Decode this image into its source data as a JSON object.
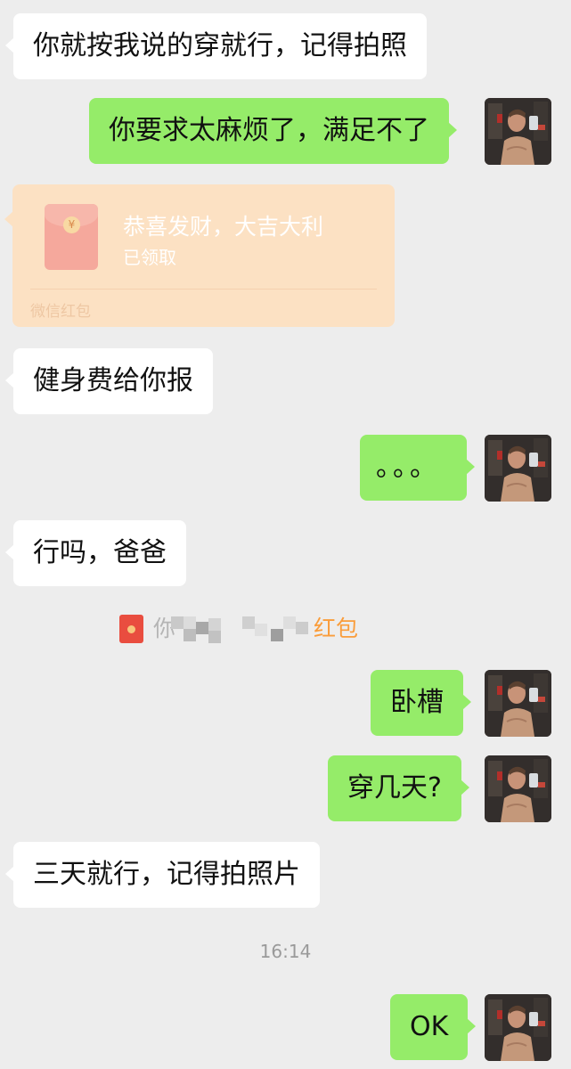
{
  "messages": [
    {
      "side": "left",
      "text": "你就按我说的穿就行，记得拍照"
    },
    {
      "side": "right",
      "text": "你要求太麻烦了，满足不了"
    },
    {
      "side": "left",
      "text": "健身费给你报"
    },
    {
      "side": "right",
      "text": "。。。"
    },
    {
      "side": "left",
      "text": "行吗，爸爸"
    },
    {
      "side": "right",
      "text": "卧槽"
    },
    {
      "side": "right",
      "text": "穿几天?"
    },
    {
      "side": "left",
      "text": "三天就行，记得拍照片"
    },
    {
      "side": "right",
      "text": "OK"
    }
  ],
  "red_packet": {
    "title": "恭喜发财，大吉大利",
    "status": "已领取",
    "footer": "微信红包",
    "coin_symbol": "¥"
  },
  "system_notice": {
    "visible_prefix": "你",
    "link_text": "红包"
  },
  "timestamp": "16:14",
  "colors": {
    "background": "#ededed",
    "sent_bubble": "#95ec69",
    "received_bubble": "#ffffff",
    "red_packet": "#fce1c3",
    "notice_link": "#fa9d3b"
  },
  "icons": {
    "avatar": "self-avatar-photo",
    "red_packet": "red-envelope-icon"
  }
}
